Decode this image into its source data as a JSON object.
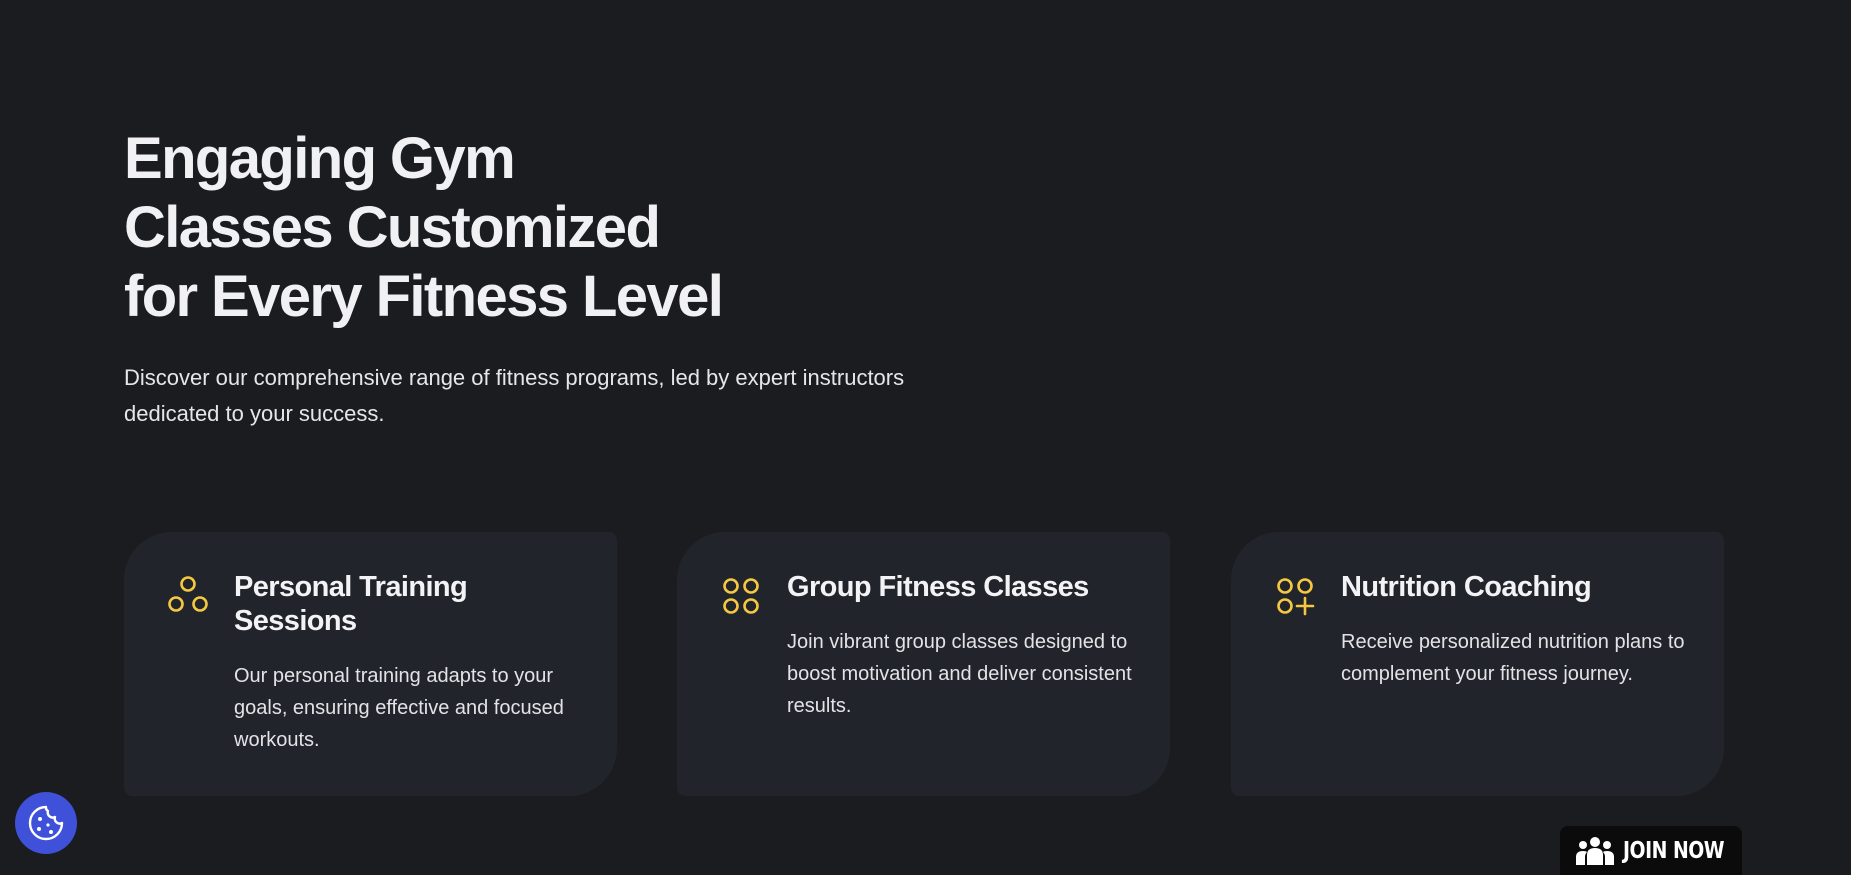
{
  "hero": {
    "title_lines": [
      "Engaging Gym",
      "Classes Customized",
      "for Every Fitness Level"
    ],
    "subtitle": "Discover our comprehensive range of fitness programs, led by expert instructors dedicated to your success."
  },
  "cards": [
    {
      "title": "Personal Training Sessions",
      "text": "Our personal training adapts to your goals, ensuring effective and focused workouts.",
      "icon": "three-circles-icon"
    },
    {
      "title": "Group Fitness Classes",
      "text": "Join vibrant group classes designed to boost motivation and deliver consistent results.",
      "icon": "four-circles-icon"
    },
    {
      "title": "Nutrition Coaching",
      "text": "Receive personalized nutrition plans to complement your fitness journey.",
      "icon": "circles-plus-icon"
    }
  ],
  "floating": {
    "join_label": "JOIN NOW",
    "join_icon": "group-people-icon",
    "cookie_icon": "cookie-icon"
  },
  "colors": {
    "background": "#1b1c20",
    "card": "#21242a",
    "accent": "#f5c842",
    "cookie_button": "#3f51d8",
    "join_button": "#0b0b0c"
  }
}
